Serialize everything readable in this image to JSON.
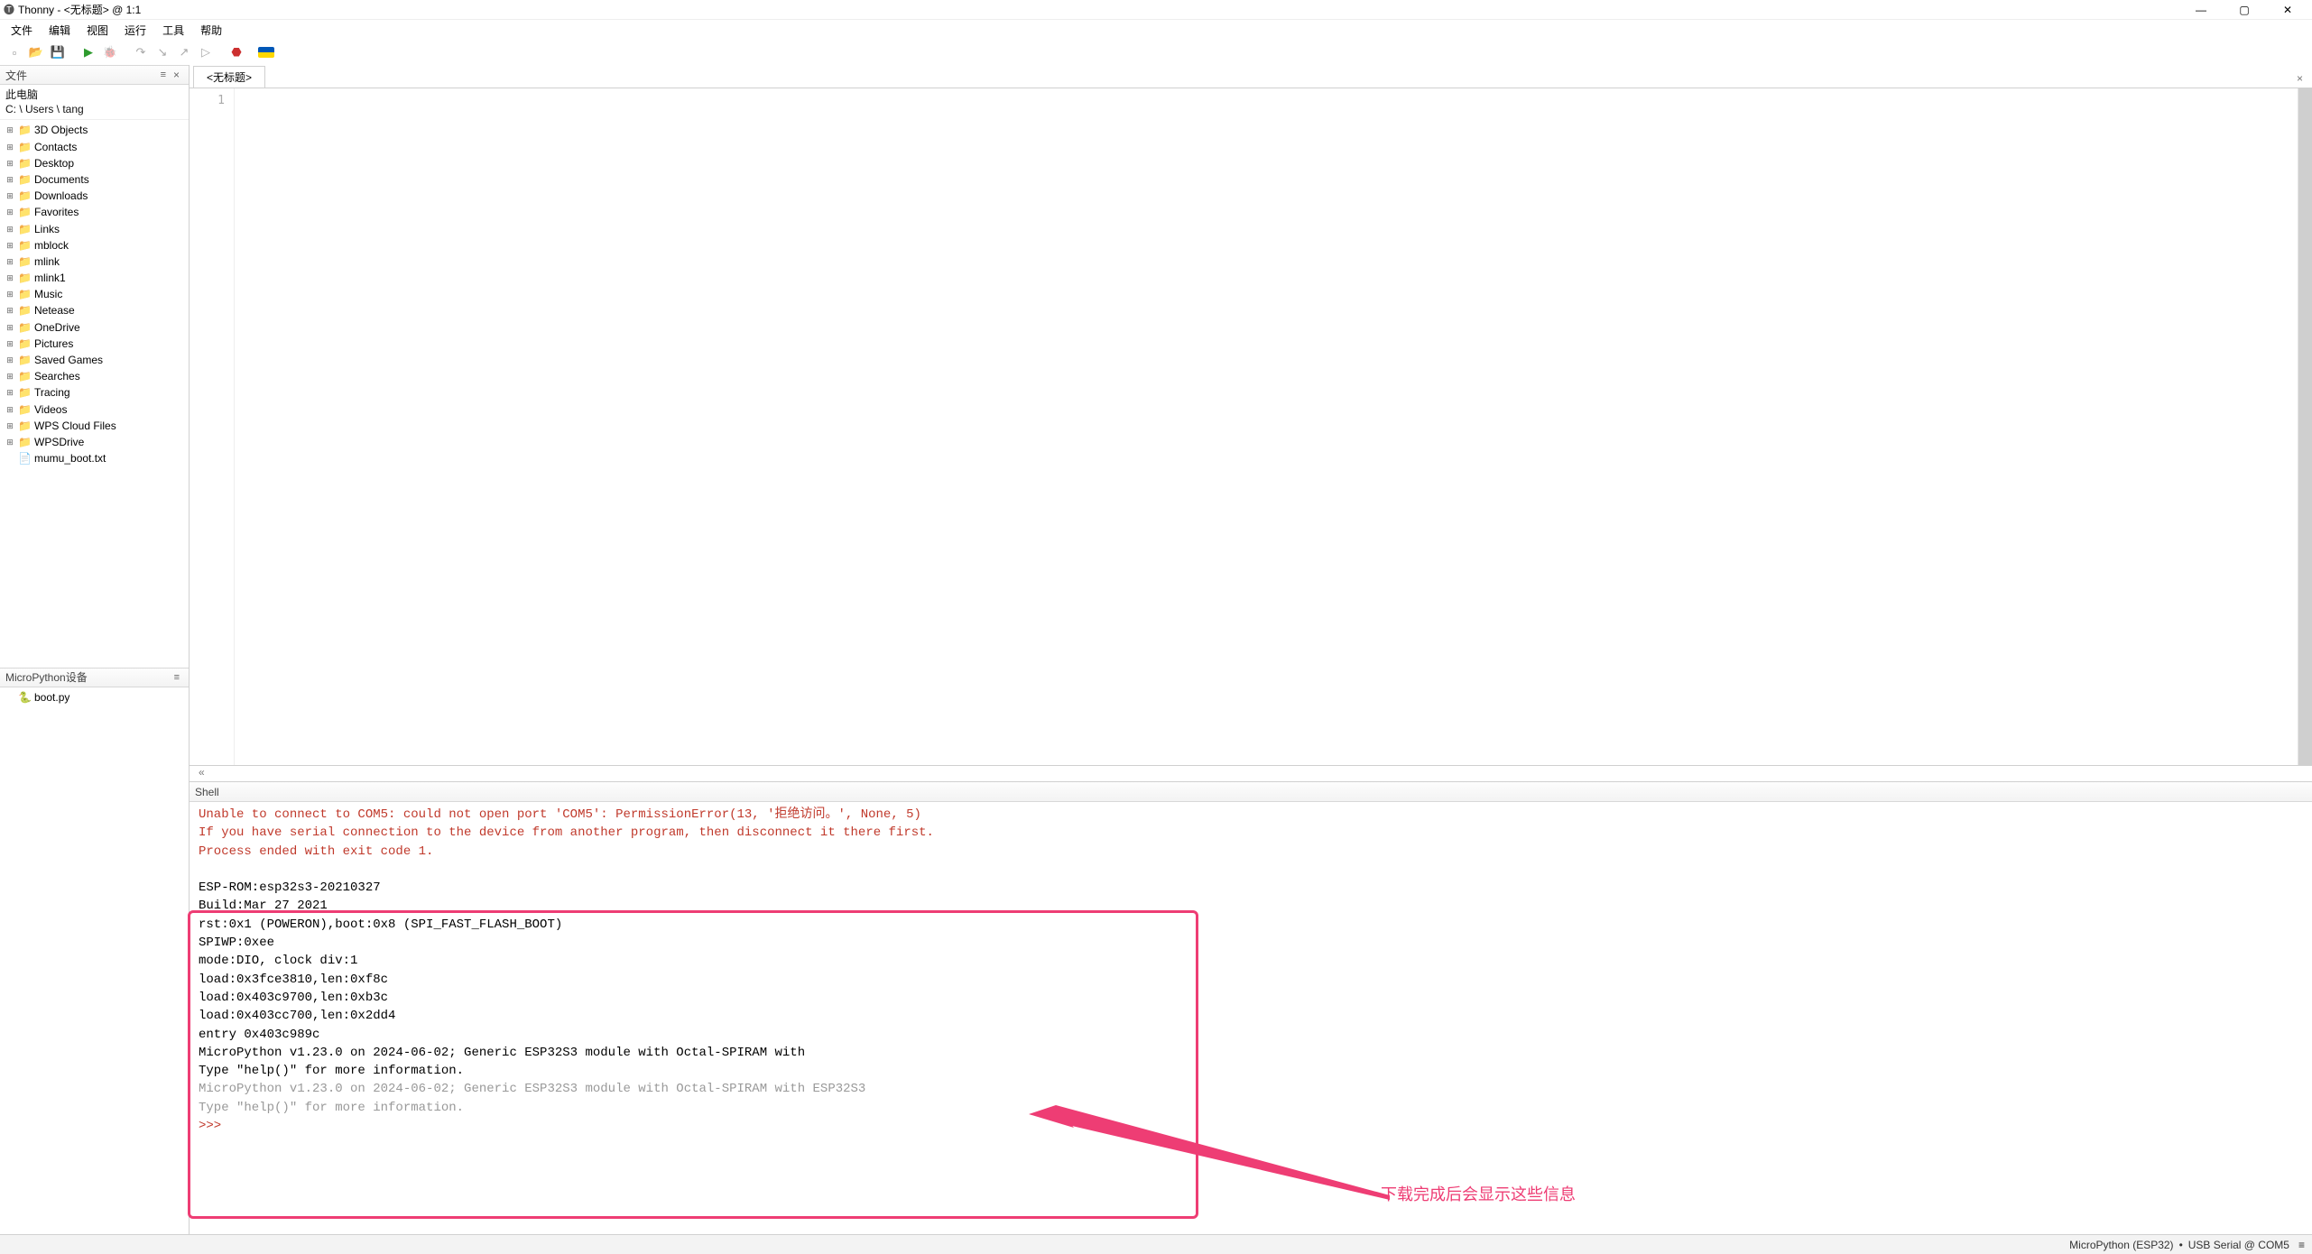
{
  "titlebar": {
    "app": "Thonny",
    "doc": "<无标题>",
    "pos": "@ 1:1"
  },
  "menus": [
    "文件",
    "编辑",
    "视图",
    "运行",
    "工具",
    "帮助"
  ],
  "toolbar_icons": [
    {
      "name": "new-file-icon",
      "glyph": "▫",
      "cls": "new-icon"
    },
    {
      "name": "open-file-icon",
      "glyph": "📂",
      "cls": "open-icon"
    },
    {
      "name": "save-file-icon",
      "glyph": "💾",
      "cls": "save-icon"
    },
    {
      "name": "sep",
      "glyph": "",
      "cls": ""
    },
    {
      "name": "run-icon",
      "glyph": "▶",
      "cls": "run-icon"
    },
    {
      "name": "debug-icon",
      "glyph": "🐞",
      "cls": "disabled"
    },
    {
      "name": "sep",
      "glyph": "",
      "cls": ""
    },
    {
      "name": "step-over-icon",
      "glyph": "↷",
      "cls": "disabled"
    },
    {
      "name": "step-into-icon",
      "glyph": "↘",
      "cls": "disabled"
    },
    {
      "name": "step-out-icon",
      "glyph": "↗",
      "cls": "disabled"
    },
    {
      "name": "resume-icon",
      "glyph": "▷",
      "cls": "disabled"
    },
    {
      "name": "sep",
      "glyph": "",
      "cls": ""
    },
    {
      "name": "stop-icon",
      "glyph": "⬣",
      "cls": "stop-icon"
    },
    {
      "name": "sep",
      "glyph": "",
      "cls": ""
    }
  ],
  "files_panel": {
    "title": "文件",
    "path_label": "此电脑",
    "path": "C: \\ Users \\ tang",
    "items": [
      {
        "name": "3D Objects",
        "type": "folder"
      },
      {
        "name": "Contacts",
        "type": "folder"
      },
      {
        "name": "Desktop",
        "type": "folder"
      },
      {
        "name": "Documents",
        "type": "folder"
      },
      {
        "name": "Downloads",
        "type": "folder"
      },
      {
        "name": "Favorites",
        "type": "folder"
      },
      {
        "name": "Links",
        "type": "folder"
      },
      {
        "name": "mblock",
        "type": "folder"
      },
      {
        "name": "mlink",
        "type": "folder"
      },
      {
        "name": "mlink1",
        "type": "folder"
      },
      {
        "name": "Music",
        "type": "folder"
      },
      {
        "name": "Netease",
        "type": "folder"
      },
      {
        "name": "OneDrive",
        "type": "folder"
      },
      {
        "name": "Pictures",
        "type": "folder"
      },
      {
        "name": "Saved Games",
        "type": "folder"
      },
      {
        "name": "Searches",
        "type": "folder"
      },
      {
        "name": "Tracing",
        "type": "folder"
      },
      {
        "name": "Videos",
        "type": "folder"
      },
      {
        "name": "WPS Cloud Files",
        "type": "folder"
      },
      {
        "name": "WPSDrive",
        "type": "folder"
      },
      {
        "name": "mumu_boot.txt",
        "type": "file"
      }
    ]
  },
  "mp_panel": {
    "title": "MicroPython设备",
    "items": [
      {
        "name": "boot.py",
        "type": "py"
      }
    ]
  },
  "editor": {
    "tab": "<无标题>",
    "line_numbers": [
      "1"
    ]
  },
  "shell": {
    "title": "Shell",
    "err_lines": [
      "Unable to connect to COM5: could not open port 'COM5': PermissionError(13, '拒绝访问。', None, 5)",
      "",
      "If you have serial connection to the device from another program, then disconnect it there first.",
      "",
      "Process ended with exit code 1."
    ],
    "boot_lines": [
      "ESP-ROM:esp32s3-20210327",
      "Build:Mar 27 2021",
      "rst:0x1 (POWERON),boot:0x8 (SPI_FAST_FLASH_BOOT)",
      "SPIWP:0xee",
      "mode:DIO, clock div:1",
      "load:0x3fce3810,len:0xf8c",
      "load:0x403c9700,len:0xb3c",
      "load:0x403cc700,len:0x2dd4",
      "entry 0x403c989c",
      "MicroPython v1.23.0 on 2024-06-02; Generic ESP32S3 module with Octal-SPIRAM with",
      "Type \"help()\" for more information."
    ],
    "gray_lines": [
      "MicroPython v1.23.0 on 2024-06-02; Generic ESP32S3 module with Octal-SPIRAM with ESP32S3",
      "",
      "Type \"help()\" for more information."
    ],
    "prompt": ">>> "
  },
  "status": {
    "interpreter": "MicroPython (ESP32)",
    "port": "USB Serial @ COM5"
  },
  "annotation": "下载完成后会显示这些信息"
}
